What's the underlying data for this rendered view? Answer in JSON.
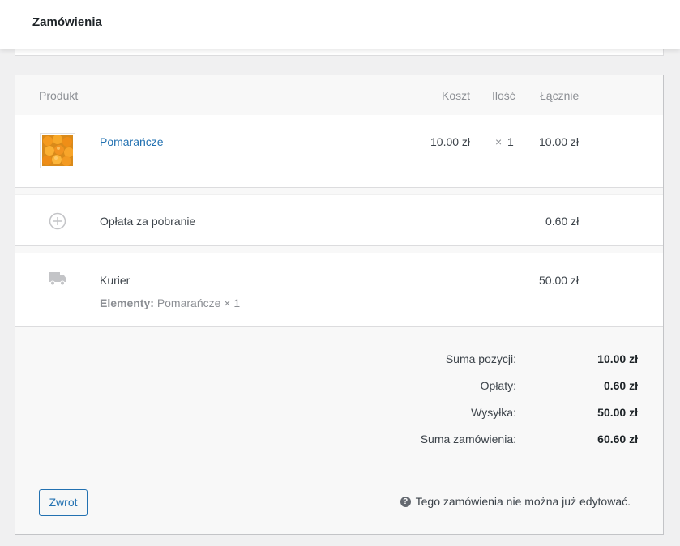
{
  "topbar": {
    "title": "Zamówienia"
  },
  "table": {
    "headers": {
      "product": "Produkt",
      "cost": "Koszt",
      "qty": "Ilość",
      "total": "Łącznie"
    },
    "item": {
      "name": "Pomarańcze",
      "cost": "10.00 zł",
      "qty_symbol": "×",
      "qty": "1",
      "total": "10.00 zł",
      "thumbnail": "oranges-image"
    },
    "fee": {
      "name": "Opłata za pobranie",
      "total": "0.60 zł",
      "icon": "plus-circle-icon"
    },
    "shipping": {
      "name": "Kurier",
      "total": "50.00 zł",
      "items_label": "Elementy:",
      "items_value": "Pomarańcze × 1",
      "icon": "truck-icon"
    }
  },
  "totals": [
    {
      "label": "Suma pozycji:",
      "value": "10.00 zł"
    },
    {
      "label": "Opłaty:",
      "value": "0.60 zł"
    },
    {
      "label": "Wysyłka:",
      "value": "50.00 zł"
    },
    {
      "label": "Suma zamówienia:",
      "value": "60.60 zł"
    }
  ],
  "footer": {
    "refund_button": "Zwrot",
    "notice": "Tego zamówienia nie można już edytować.",
    "notice_icon": "help-icon"
  },
  "colors": {
    "link": "#2271b1",
    "border": "#c3c4c7",
    "muted": "#8c8f94"
  }
}
